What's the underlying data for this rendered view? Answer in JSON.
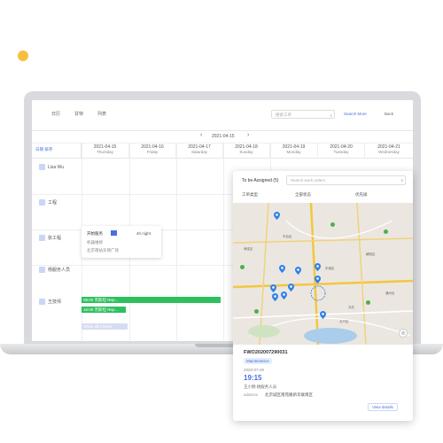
{
  "colors": {
    "accent_dot": "#f5c03c",
    "primary": "#4a6ee0",
    "green": "#2ec05c",
    "pin": "#2f80ed"
  },
  "toolbar": {
    "btn1": "日历",
    "btn2": "甘特",
    "btn3": "列表",
    "search_placeholder": "搜索工单",
    "search_more": "Search More",
    "back": "Back"
  },
  "datenav": {
    "label": "2021-04-15"
  },
  "grid": {
    "corner": "日期   排序",
    "days": [
      {
        "date": "2021-04-15",
        "weekday": "Thursday"
      },
      {
        "date": "2021-04-16",
        "weekday": "Friday"
      },
      {
        "date": "2021-04-17",
        "weekday": "Saturday"
      },
      {
        "date": "2021-04-18",
        "weekday": "Sunday"
      },
      {
        "date": "2021-04-19",
        "weekday": "Monday"
      },
      {
        "date": "2021-04-20",
        "weekday": "Tuesday"
      },
      {
        "date": "2021-04-21",
        "weekday": "Wednesday"
      }
    ],
    "rows": [
      "Lisa Wu",
      "工程",
      "张工程",
      "杨服务人员",
      "王技师"
    ]
  },
  "card": {
    "title": "开始服务",
    "duration": "4h night",
    "line1": "机器维修",
    "line2": "北京南站东侧广场"
  },
  "bars": [
    {
      "text": "08:00  杰斯坦  Rep..."
    },
    {
      "text": "16:00  杰斯坦  Rep..."
    },
    {
      "text": "Show all 3 items"
    }
  ],
  "popup": {
    "tab": "To be Assigned (5)",
    "search_placeholder": "Search work orders",
    "filter1": "工单类型",
    "filter2": "全部状态",
    "filter3": "优先级",
    "order_no": "FWO202007290031",
    "tag": "Maintenance",
    "date": "2020-07-29",
    "time": "19:15",
    "person": "王小明  杨服务人员",
    "address_label": "address",
    "address": "北京城区南苑路新华联南区",
    "link": "View details"
  },
  "map_labels": [
    "丰台区",
    "大兴区",
    "朝阳区",
    "海淀区",
    "通州区",
    "东城区",
    "亦庄"
  ]
}
